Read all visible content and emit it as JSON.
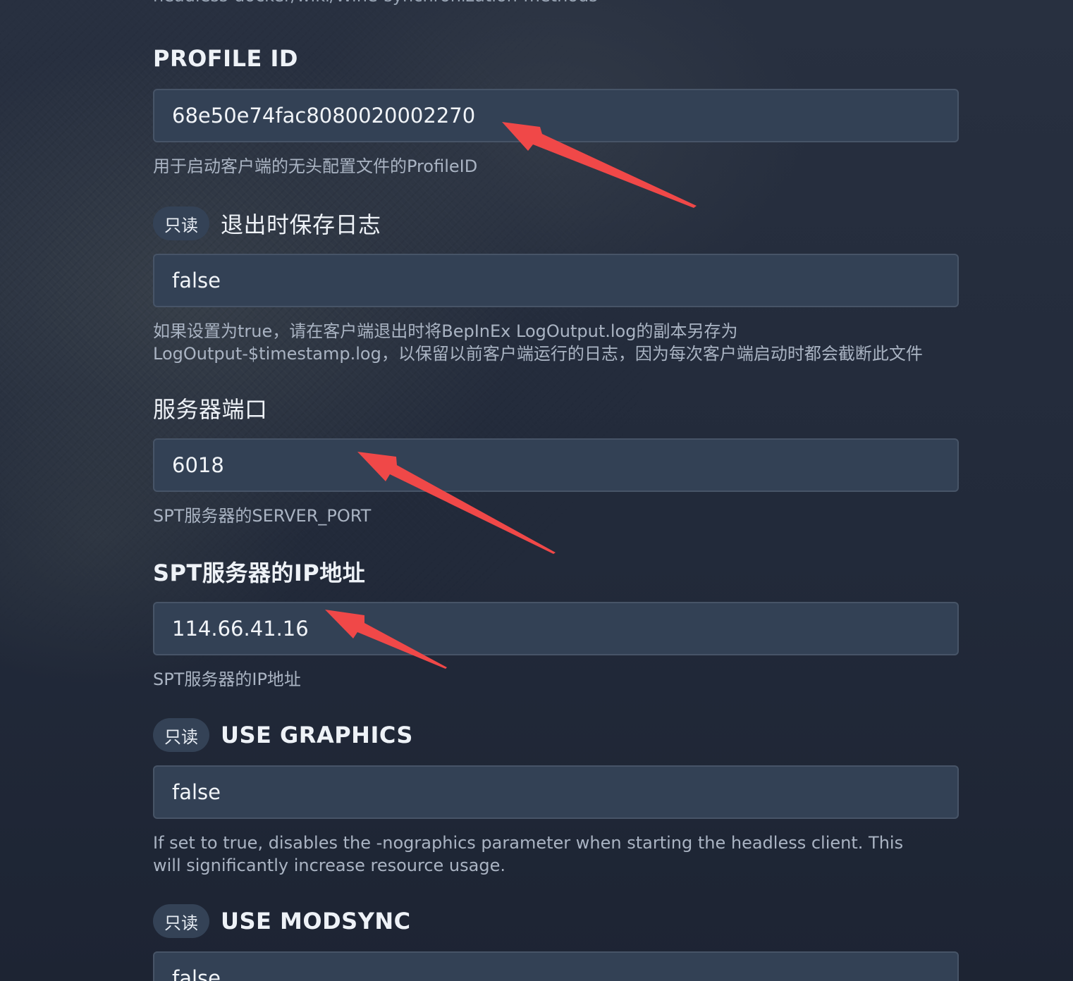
{
  "top_truncated_text": "headless-docker/wiki/Wine-synchronization-methods",
  "badge_readonly": "只读",
  "fields": [
    {
      "label": "PROFILE ID",
      "value": "68e50e74fac8080020002270",
      "help": "用于启动客户端的无头配置文件的ProfileID"
    },
    {
      "label": "退出时保存日志",
      "value": "false",
      "help": "如果设置为true，请在客户端退出时将BepInEx LogOutput.log的副本另存为 LogOutput-$timestamp.log，以保留以前客户端运行的日志，因为每次客户端启动时都会截断此文件"
    },
    {
      "label": "服务器端口",
      "value": "6018",
      "help": "SPT服务器的SERVER_PORT"
    },
    {
      "label": "SPT服务器的IP地址",
      "value": "114.66.41.16",
      "help": "SPT服务器的IP地址"
    },
    {
      "label": "USE GRAPHICS",
      "value": "false",
      "help": "If set to true, disables the -nographics parameter when starting the headless client. This will significantly increase resource usage."
    },
    {
      "label": "USE MODSYNC",
      "value": "false",
      "help": ""
    }
  ],
  "colors": {
    "arrow": "#f04848",
    "input_bg": "#334155",
    "badge_bg": "#344256"
  }
}
